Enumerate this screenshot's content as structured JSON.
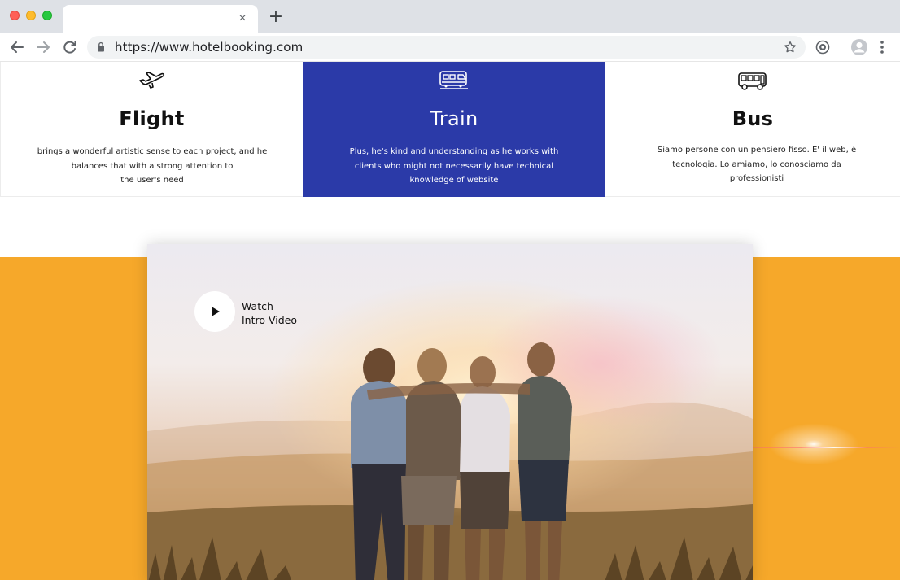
{
  "browser": {
    "tab": {
      "close_glyph": "×"
    },
    "new_tab_glyph": "+",
    "url": "https://www.hotelbooking.com",
    "icons": [
      "back-icon",
      "forward-icon",
      "reload-icon",
      "lock-icon",
      "star-icon",
      "extension-icon",
      "profile-icon",
      "menu-icon"
    ]
  },
  "cards": [
    {
      "icon": "airplane-icon",
      "title": "Flight",
      "lines": [
        "brings a wonderful artistic sense to each project, and he",
        "balances that with a strong attention to",
        "the user's need"
      ]
    },
    {
      "icon": "train-icon",
      "title": "Train",
      "lines": [
        "Plus, he's kind and understanding as he works with",
        "clients who might not necessarily have technical",
        "knowledge of website"
      ],
      "highlight_color": "#2b3aa8"
    },
    {
      "icon": "bus-icon",
      "title": "Bus",
      "lines": [
        "Siamo persone con un pensiero fisso. E' il web, è",
        "tecnologia. Lo amiamo, lo conosciamo da",
        "professionisti"
      ]
    }
  ],
  "video": {
    "watch_line1": "Watch",
    "watch_line2": "Intro Video",
    "play_icon": "play-icon"
  },
  "colors": {
    "accent_blue": "#2b3aa8",
    "band_orange": "#f6a82a"
  }
}
